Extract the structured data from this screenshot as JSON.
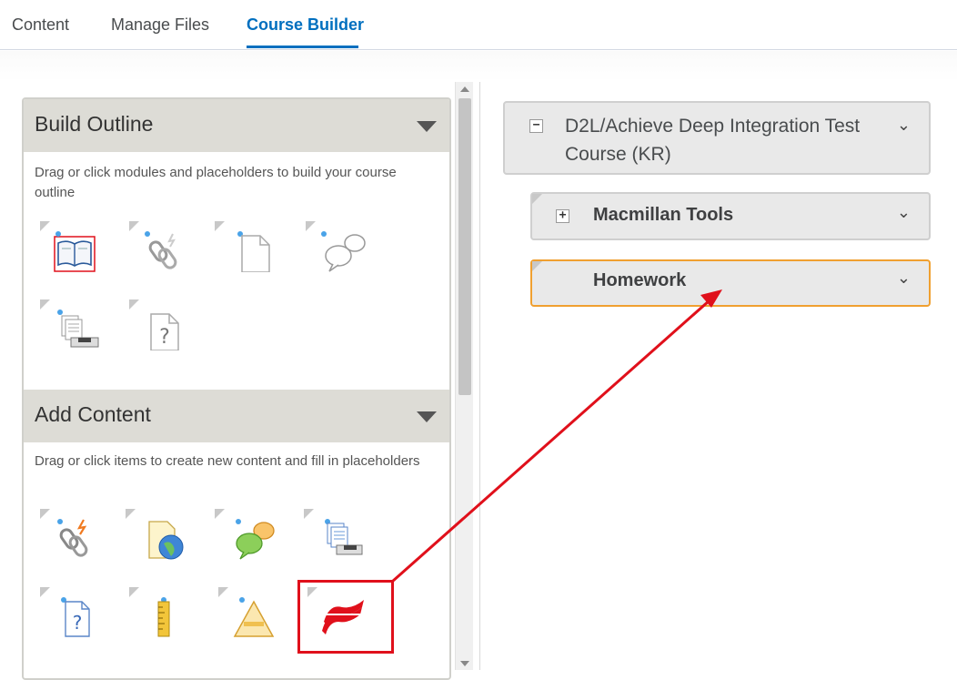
{
  "tabs": [
    {
      "label": "Content"
    },
    {
      "label": "Manage Files"
    },
    {
      "label": "Course Builder"
    }
  ],
  "build_outline": {
    "title": "Build Outline",
    "description": "Drag or click modules and placeholders to build your course outline",
    "tiles": [
      "book-module-icon",
      "link-placeholder-icon",
      "document-placeholder-icon",
      "discussion-placeholder-icon",
      "dropbox-placeholder-icon",
      "quiz-placeholder-icon"
    ]
  },
  "add_content": {
    "title": "Add Content",
    "description": "Drag or click items to create new content and fill in placeholders",
    "tiles": [
      "link-content-icon",
      "web-page-icon",
      "discussion-content-icon",
      "dropbox-content-icon",
      "quiz-content-icon",
      "ruler-icon",
      "survey-icon",
      "macmillan-logo-icon"
    ]
  },
  "tree": {
    "root": {
      "label": "D2L/Achieve Deep Integration Test Course (KR)",
      "expander": "−"
    },
    "children": [
      {
        "label": "Macmillan Tools",
        "expander": "+"
      },
      {
        "label": "Homework"
      }
    ]
  },
  "colors": {
    "accent": "#006fbf",
    "highlight": "#e0101b",
    "drop_target": "#f0a030",
    "panel_head": "#dddcd6"
  }
}
